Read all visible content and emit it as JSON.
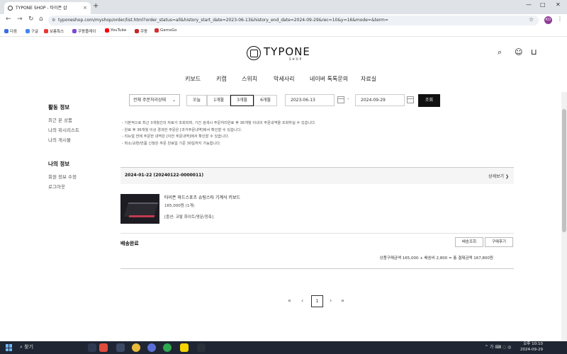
{
  "browser": {
    "tab_title": "TYPONE SHOP - 타이픈 샵",
    "tab_close": "×",
    "new_tab": "+",
    "url": "typoneshop.com/myshop/order/list.html?order_status=all&history_start_date=2023-06-13&history_end_date=2024-09-29&rec=10&y=16&mode=&term=",
    "profile": "KD",
    "bookmarks": [
      "다음",
      "구글",
      "보름특스",
      "쿠팡플레이",
      "YouTube",
      "쿠팡",
      "GamsGo"
    ],
    "bookmark_colors": [
      "#3a6fe0",
      "#4285f4",
      "#e53935",
      "#7b4bd6",
      "#ff0000",
      "#c62828",
      "#d32f2f"
    ]
  },
  "site": {
    "logo": "TYPONE",
    "logo_sub": "SHOP",
    "nav": [
      "키보드",
      "키캡",
      "스위치",
      "악세사리",
      "네이버 톡톡문의",
      "자료실"
    ]
  },
  "sidebar": {
    "sections": [
      {
        "title": "활동 정보",
        "items": [
          "최근 본 상품",
          "나의 위시리스트",
          "나의 게시물"
        ]
      },
      {
        "title": "나의 정보",
        "items": [
          "회원 정보 수정",
          "로그아웃"
        ]
      }
    ]
  },
  "filter": {
    "status_select": "전체 주문처리상태",
    "periods": [
      "오늘",
      "1개월",
      "3개월",
      "6개월"
    ],
    "active_period": "3개월",
    "start_date": "2023-06-13",
    "end_date": "2024-09-29",
    "search_label": "조회"
  },
  "notes": [
    "- 기본적으로 최근 3개월간의 자료가 조회되며, 기간 검색시 주문처리완료 후 36개월 이내의 주문내역을 조회하실 수 있습니다.",
    "- 완료 후 36개월 이상 경과한 주문은 [과거주문내역]에서 확인할 수 있습니다.",
    "- 리뉴얼 전에 주문한 내역은 [이전 주문내역]에서 확인할 수 있습니다.",
    "- 취소/교환/반품 신청은 주문 완료일 기준 30일까지 가능합니다."
  ],
  "order": {
    "id": "2024-01-22 (20240122-0000011)",
    "detail_link": "상세보기 ❯",
    "product_name": "타이픈 마드스포츠 슈팅스타 기계식 키보드",
    "product_price": "165,000원 (1개)",
    "product_option": "[옵션: 코랄 화이트/영문/정축]",
    "status": "배송완료",
    "buttons": [
      "배송조회",
      "구매후기"
    ],
    "total": "상품구매금액 165,000 + 배송비 2,800 = 총 결제금액 167,800원"
  },
  "pagination": {
    "first": "«",
    "prev": "‹",
    "current": "1",
    "next": "›",
    "last": "»"
  },
  "taskbar": {
    "search": "찾기",
    "tray": "^ 가 ⌨ ◌ ◎",
    "time": "오후 10:10",
    "date": "2024-09-29"
  }
}
